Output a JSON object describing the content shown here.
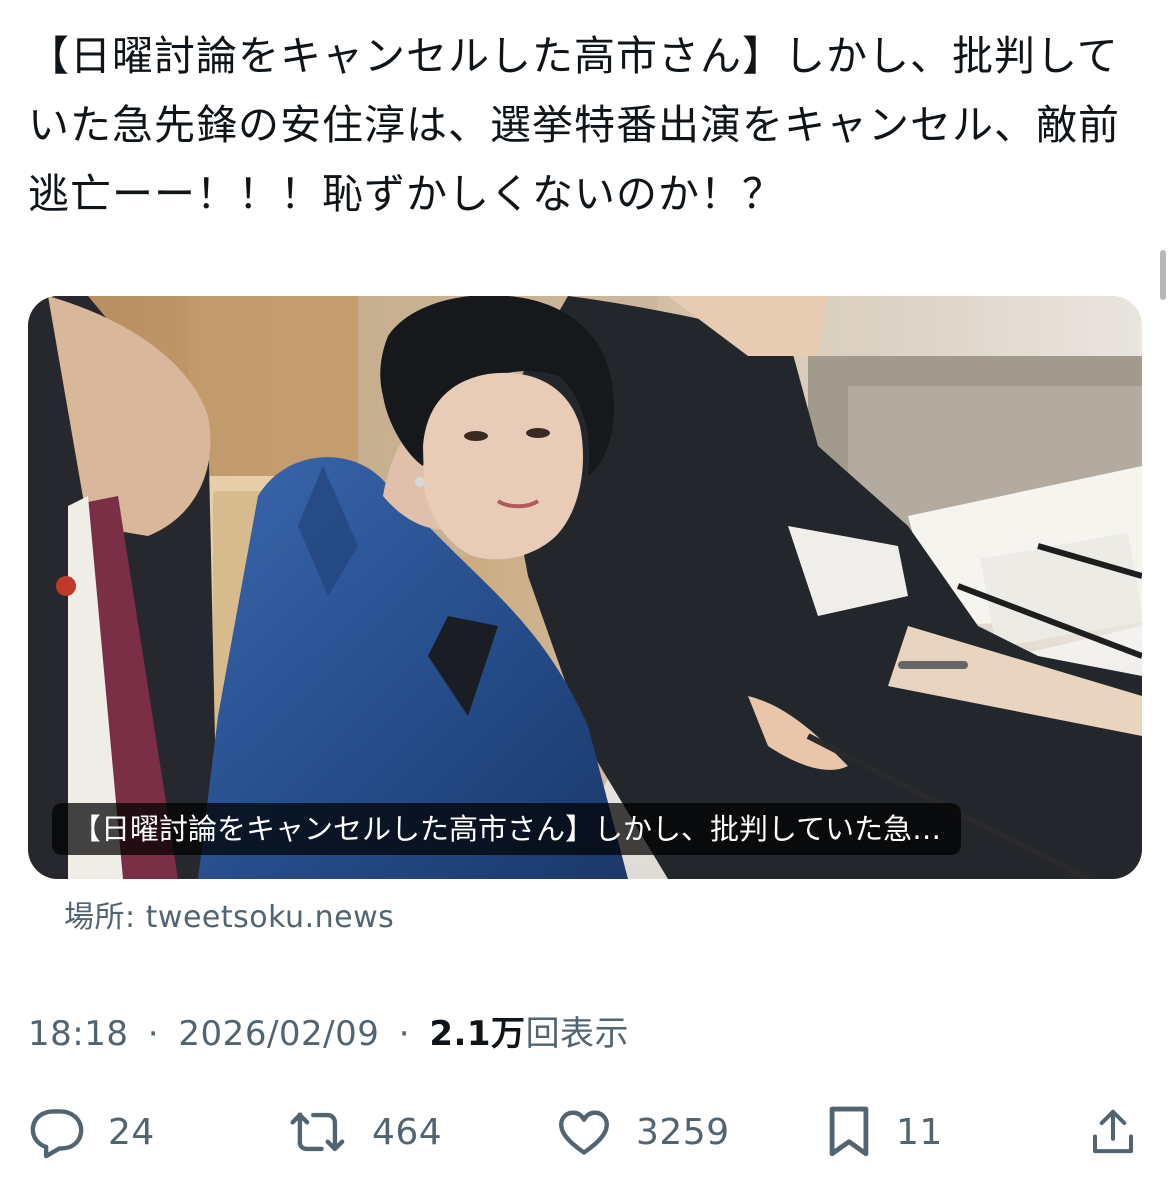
{
  "tweet": {
    "text": "【日曜討論をキャンセルした高市さん】しかし、批判していた急先鋒の安住淳は、選挙特番出演をキャンセル、敵前逃亡ーー！！！恥ずかしくないのか！？"
  },
  "card": {
    "caption": "【日曜討論をキャンセルした高市さん】しかし、批判していた急…",
    "source": "場所: tweetsoku.news"
  },
  "meta": {
    "time": "18:18",
    "separator": "·",
    "date": "2026/02/09",
    "views_count": "2.1万",
    "views_label": "回表示"
  },
  "actions": {
    "reply_count": "24",
    "repost_count": "464",
    "like_count": "3259",
    "bookmark_count": "11"
  },
  "colors": {
    "text": "#0f1419",
    "secondary": "#536471",
    "jacket_blue": "#274f8f"
  },
  "icons": [
    "reply-icon",
    "repost-icon",
    "like-icon",
    "bookmark-icon",
    "share-icon"
  ]
}
